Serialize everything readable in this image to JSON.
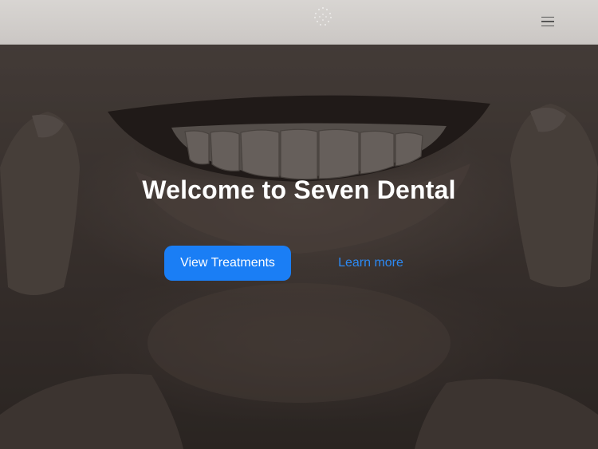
{
  "header": {
    "logo_icon": "dotted-circle-logo-icon",
    "menu_icon": "hamburger-menu-icon"
  },
  "hero": {
    "title": "Welcome to Seven Dental",
    "primary_cta_label": "View Treatments",
    "secondary_cta_label": "Learn more"
  },
  "colors": {
    "primary": "#1a7ef5",
    "link": "#2c8af5",
    "header_bg": "#d2cecb",
    "hero_overlay": "#3a3330"
  }
}
